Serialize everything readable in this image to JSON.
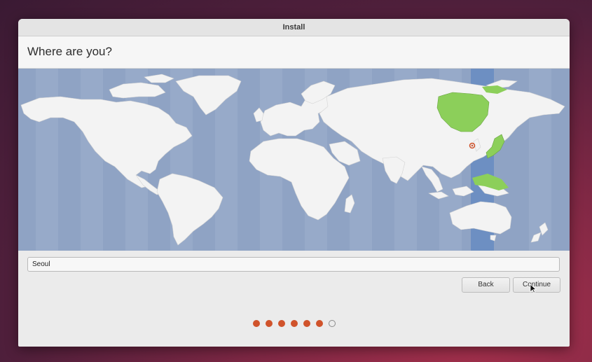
{
  "window": {
    "title": "Install"
  },
  "header": {
    "title": "Where are you?"
  },
  "location": {
    "value": "Seoul"
  },
  "buttons": {
    "back_label": "Back",
    "continue_label": "Continue"
  },
  "progress": {
    "total_steps": 7,
    "completed_steps": 6
  },
  "colors": {
    "map_water": "#8fa3c4",
    "land": "#f3f3f3",
    "selected_zone": "#6d8fc2",
    "selected_region": "#8ccf5a",
    "progress_dot": "#d0532b"
  }
}
